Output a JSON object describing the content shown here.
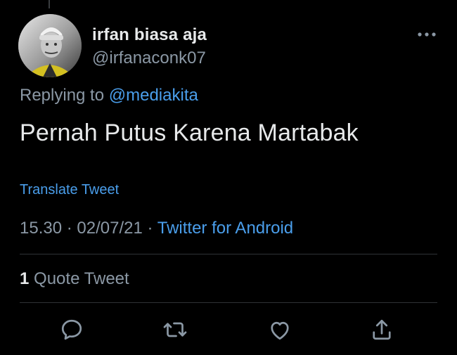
{
  "author": {
    "display_name": "irfan biasa aja",
    "handle": "@irfanaconk07"
  },
  "reply": {
    "prefix": "Replying to",
    "mention": "@mediakita"
  },
  "tweet": {
    "text": "Pernah Putus Karena Martabak",
    "translate_label": "Translate Tweet",
    "time": "15.30",
    "date": "02/07/21",
    "separator": "·",
    "source": "Twitter for Android"
  },
  "stats": {
    "quote_count": "1",
    "quote_label": "Quote Tweet"
  },
  "icons": {
    "more": "more-horizontal-icon",
    "reply": "reply-icon",
    "retweet": "retweet-icon",
    "like": "heart-icon",
    "share": "share-icon"
  },
  "colors": {
    "background": "#000000",
    "text_primary": "#e7e9ea",
    "text_secondary": "#8b98a5",
    "link": "#4a9eeb",
    "divider": "#2f3336"
  }
}
